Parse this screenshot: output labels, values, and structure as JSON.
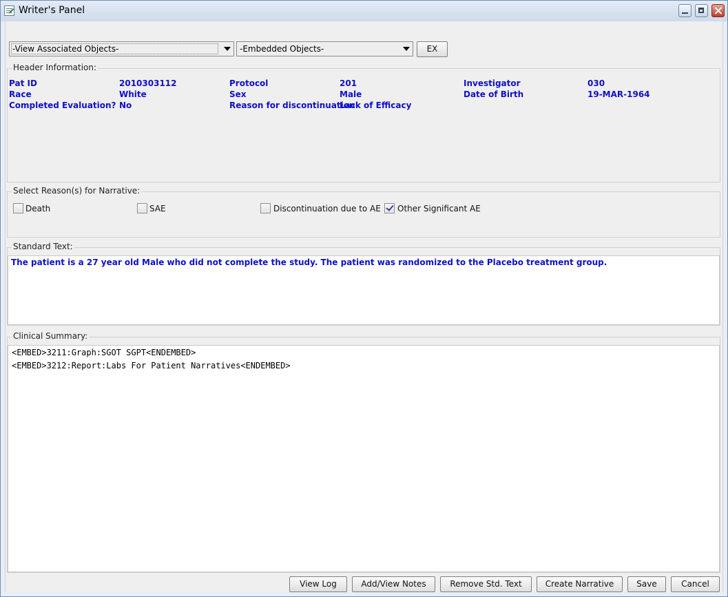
{
  "window": {
    "title": "Writer's Panel"
  },
  "toolbar": {
    "associated_objects": "-View Associated Objects-",
    "embedded_objects": "-Embedded Objects-",
    "ex_button": "EX"
  },
  "header": {
    "label": "Header Information:",
    "fields": [
      {
        "label": "Pat ID",
        "value": "2010303112"
      },
      {
        "label": "Protocol",
        "value": "201"
      },
      {
        "label": "Investigator",
        "value": "030"
      },
      {
        "label": "Race",
        "value": "White"
      },
      {
        "label": "Sex",
        "value": "Male"
      },
      {
        "label": "Date of Birth",
        "value": "19-MAR-1964"
      },
      {
        "label": "Completed Evaluation?",
        "value": "No"
      },
      {
        "label": "Reason for discontinuation",
        "value": "Lack of Efficacy"
      }
    ]
  },
  "reasons": {
    "label": "Select Reason(s) for Narrative:",
    "options": [
      {
        "label": "Death",
        "checked": false
      },
      {
        "label": "SAE",
        "checked": false
      },
      {
        "label": "Discontinuation due to AE",
        "checked": false
      },
      {
        "label": "Other Significant AE",
        "checked": true
      }
    ]
  },
  "standard_text": {
    "label": "Standard Text:",
    "text": "The patient is a 27 year old Male who did not complete the study.  The patient was randomized to the Placebo treatment group."
  },
  "clinical_summary": {
    "label": "Clinical Summary:",
    "lines": [
      "<EMBED>3211:Graph:SGOT SGPT<ENDEMBED>",
      "<EMBED>3212:Report:Labs For Patient Narratives<ENDEMBED>"
    ]
  },
  "buttons": {
    "view_log": "View Log",
    "add_view_notes": "Add/View Notes",
    "remove_std_text": "Remove Std. Text",
    "create_narrative": "Create Narrative",
    "save": "Save",
    "cancel": "Cancel"
  }
}
